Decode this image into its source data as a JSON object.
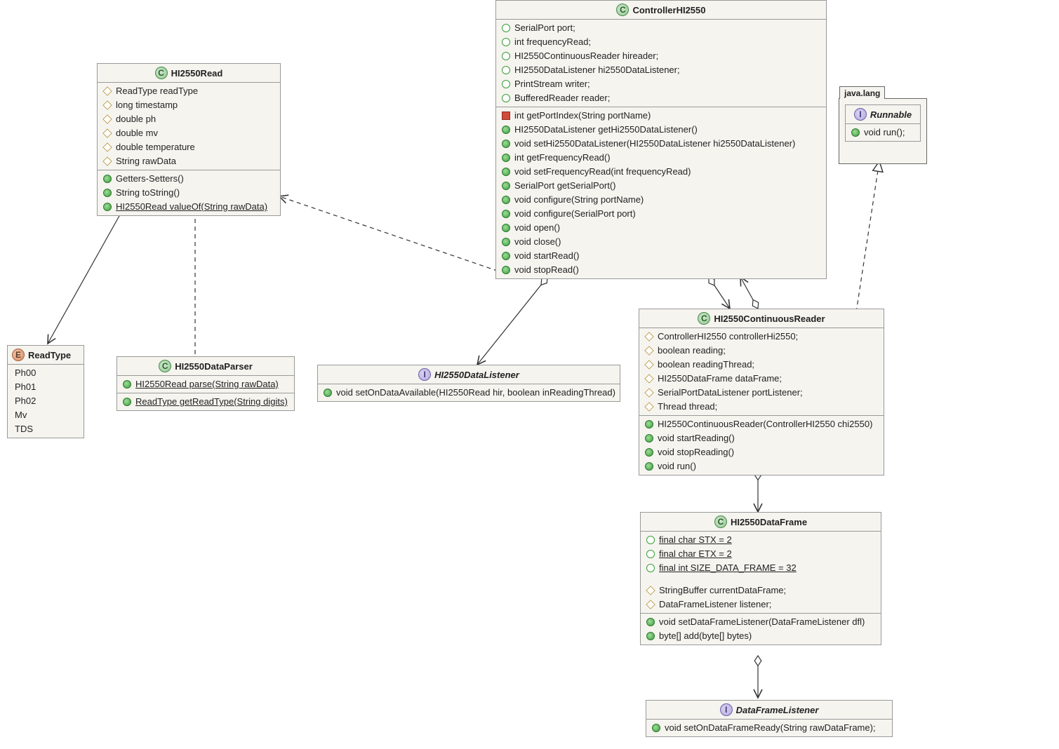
{
  "classes": {
    "HI2550Read": {
      "kind": "C",
      "title": "HI2550Read",
      "fields": [
        {
          "vis": "protected",
          "text": "ReadType readType"
        },
        {
          "vis": "protected",
          "text": "long timestamp"
        },
        {
          "vis": "protected",
          "text": "double ph"
        },
        {
          "vis": "protected",
          "text": "double mv"
        },
        {
          "vis": "protected",
          "text": "double temperature"
        },
        {
          "vis": "protected",
          "text": "String rawData"
        }
      ],
      "methods": [
        {
          "vis": "public",
          "text": "Getters-Setters()"
        },
        {
          "vis": "public",
          "text": "String toString()"
        },
        {
          "vis": "public",
          "text": "HI2550Read valueOf(String rawData)",
          "underline": true
        }
      ]
    },
    "ReadType": {
      "kind": "E",
      "title": "ReadType",
      "values": [
        "Ph00",
        "Ph01",
        "Ph02",
        "Mv",
        "TDS"
      ]
    },
    "HI2550DataParser": {
      "kind": "C",
      "title": "HI2550DataParser",
      "methods1": [
        {
          "vis": "public",
          "text": "HI2550Read parse(String rawData)",
          "underline": true
        }
      ],
      "methods2": [
        {
          "vis": "public",
          "text": "ReadType getReadType(String digits)",
          "underline": true
        }
      ]
    },
    "HI2550DataListener": {
      "kind": "I",
      "title": "HI2550DataListener",
      "methods": [
        {
          "vis": "public",
          "text": "void setOnDataAvailable(HI2550Read hir, boolean inReadingThread)"
        }
      ]
    },
    "ControllerHI2550": {
      "kind": "C",
      "title": "ControllerHI2550",
      "fields": [
        {
          "vis": "package",
          "text": "SerialPort port;"
        },
        {
          "vis": "package",
          "text": "int frequencyRead;"
        },
        {
          "vis": "package",
          "text": "HI2550ContinuousReader hireader;"
        },
        {
          "vis": "package",
          "text": "HI2550DataListener hi2550DataListener;"
        },
        {
          "vis": "package",
          "text": "PrintStream writer;"
        },
        {
          "vis": "package",
          "text": "BufferedReader reader;"
        }
      ],
      "methods": [
        {
          "vis": "private",
          "text": "int getPortIndex(String portName)"
        },
        {
          "vis": "public",
          "text": "HI2550DataListener getHi2550DataListener()"
        },
        {
          "vis": "public",
          "text": "void setHi2550DataListener(HI2550DataListener hi2550DataListener)"
        },
        {
          "vis": "public",
          "text": "int getFrequencyRead()"
        },
        {
          "vis": "public",
          "text": "void setFrequencyRead(int frequencyRead)"
        },
        {
          "vis": "public",
          "text": "SerialPort getSerialPort()"
        },
        {
          "vis": "public",
          "text": "void configure(String portName)"
        },
        {
          "vis": "public",
          "text": "void configure(SerialPort port)"
        },
        {
          "vis": "public",
          "text": "void open()"
        },
        {
          "vis": "public",
          "text": "void close()"
        },
        {
          "vis": "public",
          "text": "void startRead()"
        },
        {
          "vis": "public",
          "text": "void stopRead()"
        }
      ]
    },
    "Runnable": {
      "kind": "I",
      "package": "java.lang",
      "title": "Runnable",
      "methods": [
        {
          "vis": "public",
          "text": "void run();"
        }
      ]
    },
    "HI2550ContinuousReader": {
      "kind": "C",
      "title": "HI2550ContinuousReader",
      "fields": [
        {
          "vis": "protected",
          "text": "ControllerHI2550 controllerHi2550;"
        },
        {
          "vis": "protected",
          "text": "boolean reading;"
        },
        {
          "vis": "protected",
          "text": "boolean readingThread;"
        },
        {
          "vis": "protected",
          "text": "HI2550DataFrame dataFrame;"
        },
        {
          "vis": "protected",
          "text": "SerialPortDataListener portListener;"
        },
        {
          "vis": "protected",
          "text": "Thread thread;"
        }
      ],
      "methods": [
        {
          "vis": "public",
          "text": "HI2550ContinuousReader(ControllerHI2550 chi2550)"
        },
        {
          "vis": "public",
          "text": "void startReading()"
        },
        {
          "vis": "public",
          "text": "void stopReading()"
        },
        {
          "vis": "public",
          "text": "void run()"
        }
      ]
    },
    "HI2550DataFrame": {
      "kind": "C",
      "title": "HI2550DataFrame",
      "fields1": [
        {
          "vis": "package",
          "text": "final char STX = 2",
          "underline": true
        },
        {
          "vis": "package",
          "text": "final char ETX = 2",
          "underline": true
        },
        {
          "vis": "package",
          "text": "final int SIZE_DATA_FRAME = 32",
          "underline": true
        }
      ],
      "fields2": [
        {
          "vis": "protected",
          "text": "StringBuffer currentDataFrame;"
        },
        {
          "vis": "protected",
          "text": "DataFrameListener listener;"
        }
      ],
      "methods": [
        {
          "vis": "public",
          "text": "void setDataFrameListener(DataFrameListener dfl)"
        },
        {
          "vis": "public",
          "text": "byte[] add(byte[] bytes)"
        }
      ]
    },
    "DataFrameListener": {
      "kind": "I",
      "title": "DataFrameListener",
      "methods": [
        {
          "vis": "public",
          "text": "void setOnDataFrameReady(String rawDataFrame);"
        }
      ]
    }
  }
}
